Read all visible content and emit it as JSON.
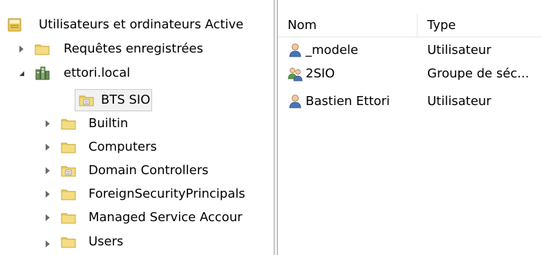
{
  "tree": {
    "root_label": "Utilisateurs et ordinateurs Active",
    "items": [
      {
        "label": "Requêtes enregistrées",
        "icon": "folder-icon",
        "expander": "closed"
      },
      {
        "label": "ettori.local",
        "icon": "domain-icon",
        "expander": "open"
      },
      {
        "label": "BTS SIO",
        "icon": "ou-folder-icon",
        "expander": "none"
      },
      {
        "label": "Builtin",
        "icon": "folder-icon",
        "expander": "closed"
      },
      {
        "label": "Computers",
        "icon": "folder-icon",
        "expander": "closed"
      },
      {
        "label": "Domain Controllers",
        "icon": "ou-folder-icon",
        "expander": "closed"
      },
      {
        "label": "ForeignSecurityPrincipals",
        "icon": "folder-icon",
        "expander": "closed"
      },
      {
        "label": "Managed Service Accour",
        "icon": "folder-icon",
        "expander": "closed"
      },
      {
        "label": "Users",
        "icon": "folder-icon",
        "expander": "closed"
      }
    ]
  },
  "list": {
    "columns": [
      "Nom",
      "Type"
    ],
    "rows": [
      {
        "name": "_modele",
        "type": "Utilisateur",
        "icon": "user-icon"
      },
      {
        "name": "2SIO",
        "type": "Groupe de séc...",
        "icon": "group-icon"
      },
      {
        "name": "Bastien Ettori",
        "type": "Utilisateur",
        "icon": "user-icon"
      }
    ]
  },
  "colors": {
    "folder": "#e8c95a",
    "folder_dark": "#c9a63a",
    "selection_border": "#c8c8c8",
    "splitter": "#f0f0f0"
  }
}
